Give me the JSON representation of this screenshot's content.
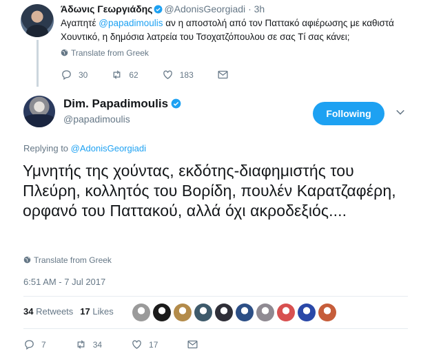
{
  "parent_tweet": {
    "author_name": "Άδωνις Γεωργιάδης",
    "handle": "@AdonisGeorgiadi",
    "separator": "·",
    "time": "3h",
    "text_before": "Αγαπητέ ",
    "mention": "@papadimoulis",
    "text_after": " αν η αποστολή από τον Παττακό αφιέρωσης με καθιστά Χουντικό, η δημόσια λατρεία του Τσοχατζόπουλου σε σας Τί σας κάνει;",
    "translate_label": "Translate from Greek",
    "reply_count": "30",
    "retweet_count": "62",
    "like_count": "183"
  },
  "main_tweet": {
    "author_name": "Dim. Papadimoulis",
    "handle": "@papadimoulis",
    "follow_label": "Following",
    "replying_label": "Replying to ",
    "replying_to": "@AdonisGeorgiadi",
    "text": "Υμνητής της χούντας, εκδότης-διαφημιστής του Πλεύρη, κολλητός του Βορίδη, πουλέν Καρατζαφέρη, ορφανό του Παττακού, αλλά όχι ακροδεξιός....",
    "translate_label": "Translate from Greek",
    "timestamp": "6:51 AM - 7 Jul 2017",
    "retweets_count": "34",
    "retweets_label": "Retweets",
    "likes_count": "17",
    "likes_label": "Likes",
    "reply_count": "7",
    "retweet_count": "34",
    "like_count": "17",
    "liker_avatar_colors": [
      "#9a9a9a",
      "#1b1b1b",
      "#b38b4a",
      "#3e5a6b",
      "#2f2f38",
      "#2c4f86",
      "#8f8a92",
      "#d85050",
      "#2a48a8",
      "#c65d3a"
    ]
  },
  "colors": {
    "accent": "#1da1f2",
    "muted_text": "#657786",
    "primary_text": "#14171a"
  }
}
